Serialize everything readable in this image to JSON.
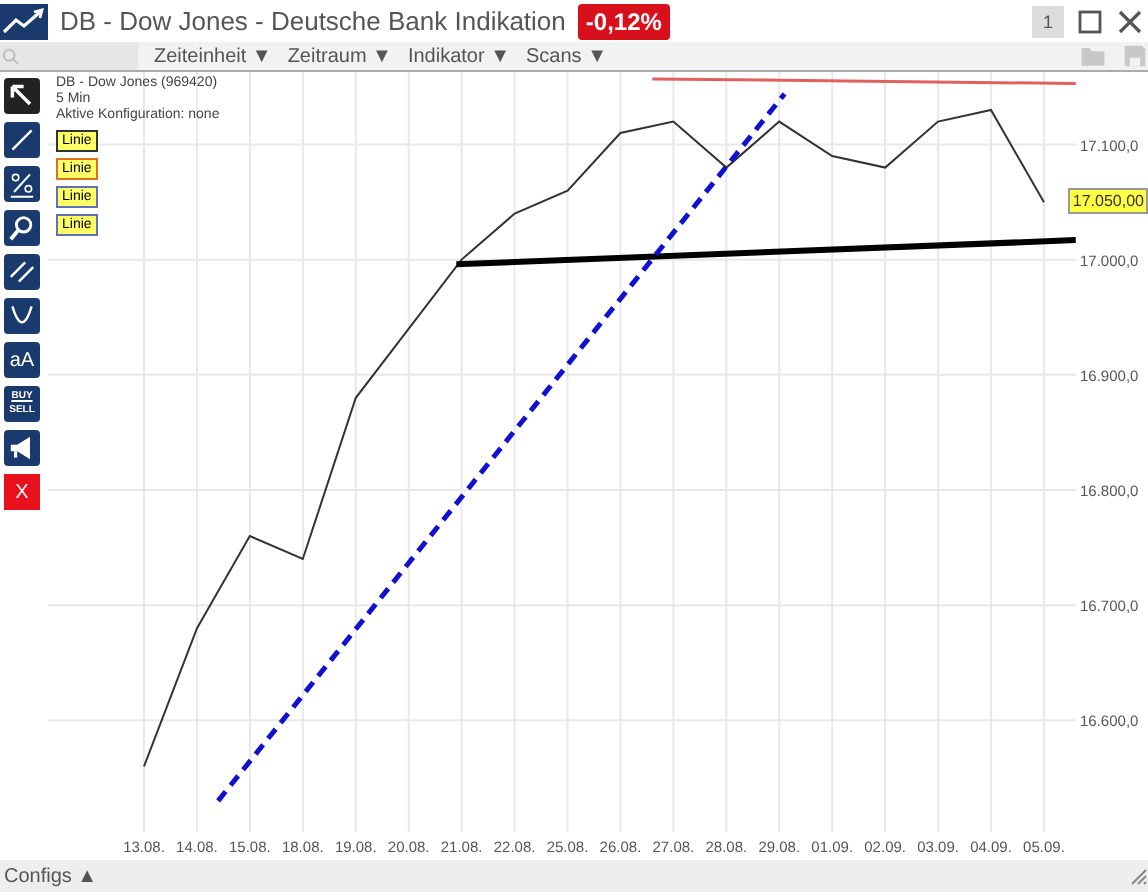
{
  "window": {
    "title": "DB - Dow Jones - Deutsche Bank Indikation",
    "change": "-0,12%",
    "controls": [
      "1"
    ]
  },
  "toolbar": {
    "menus": [
      "Zeiteinheit ▼",
      "Zeitraum ▼",
      "Indikator ▼",
      "Scans ▼"
    ]
  },
  "tools": [
    {
      "kind": "pointer",
      "selected": true
    },
    {
      "kind": "line",
      "selected": false
    },
    {
      "kind": "percent",
      "selected": false
    },
    {
      "kind": "zoom",
      "selected": false
    },
    {
      "kind": "parallel",
      "selected": false
    },
    {
      "kind": "curve",
      "selected": false
    },
    {
      "kind": "text",
      "label": "aA",
      "selected": false
    },
    {
      "kind": "buysell",
      "label": "BUY",
      "label2": "SELL",
      "selected": false
    },
    {
      "kind": "megaphone",
      "selected": false
    },
    {
      "kind": "delete",
      "label": "X",
      "selected": false
    }
  ],
  "info": {
    "instrument": "DB - Dow Jones (969420)",
    "interval": "5 Min",
    "config": "Aktive Konfiguration: none"
  },
  "drawing_labels": [
    {
      "label": "Linie",
      "color": "#333333"
    },
    {
      "label": "Linie",
      "color": "#e07020"
    },
    {
      "label": "Linie",
      "color": "#6070c0"
    },
    {
      "label": "Linie",
      "color": "#6070c0"
    }
  ],
  "price_tag": {
    "label": "17.050,00"
  },
  "chart": {
    "drawings": [
      {
        "kind": "thin",
        "color": "#e06060"
      },
      {
        "kind": "thick",
        "color": "#000000"
      },
      {
        "kind": "dashed",
        "color": "#1010d0"
      }
    ],
    "chart_data": {
      "type": "line",
      "grid": true,
      "categories": [
        "13.08.",
        "14.08.",
        "15.08.",
        "18.08.",
        "19.08.",
        "20.08.",
        "21.08.",
        "22.08.",
        "25.08.",
        "26.08.",
        "27.08.",
        "28.08.",
        "29.08.",
        "01.09.",
        "02.09.",
        "03.09.",
        "04.09.",
        "05.09."
      ],
      "ylim": [
        16503,
        17163
      ],
      "series": [
        {
          "color": "#333333",
          "values": [
            16560,
            16680,
            16760,
            16740,
            16880,
            16940,
            17000,
            17040,
            17060,
            17110,
            17120,
            17080,
            17120,
            17090,
            17080,
            17120,
            17130,
            17050
          ]
        }
      ],
      "yticks": [
        {
          "value": 16600,
          "label": "16.600,0"
        },
        {
          "value": 16700,
          "label": "16.700,0"
        },
        {
          "value": 16800,
          "label": "16.800,0"
        },
        {
          "value": 16900,
          "label": "16.900,0"
        },
        {
          "value": 17000,
          "label": "17.000,0"
        },
        {
          "value": 17100,
          "label": "17.100,0"
        }
      ]
    }
  },
  "footer": {
    "label": "Configs ▲"
  }
}
